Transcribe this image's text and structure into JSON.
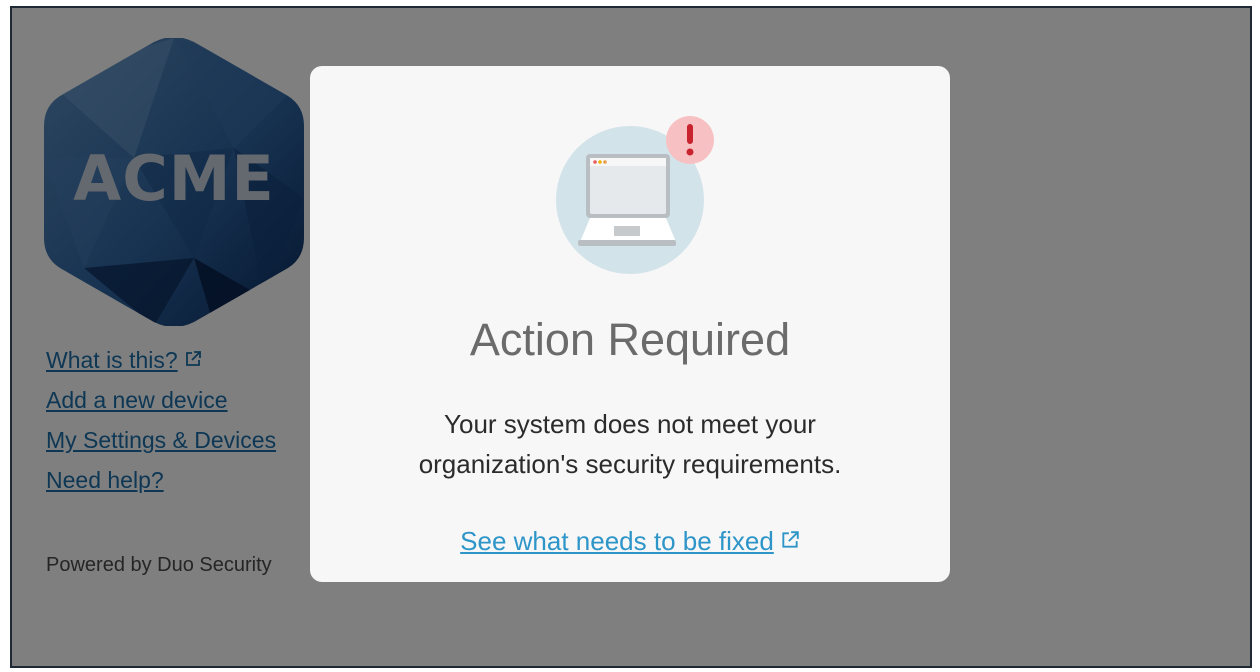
{
  "logo": {
    "text": "ACME"
  },
  "sidebar": {
    "links": [
      {
        "label": "What is this?",
        "external": true
      },
      {
        "label": "Add a new device",
        "external": false
      },
      {
        "label": "My Settings & Devices",
        "external": false
      },
      {
        "label": "Need help?",
        "external": false
      }
    ],
    "powered_by": "Powered by Duo Security"
  },
  "modal": {
    "badge_symbol": "!",
    "title": "Action Required",
    "message": "Your system does not meet your organization's security requirements.",
    "fix_link": "See what needs to be fixed"
  },
  "colors": {
    "link": "#1b6fa8",
    "modal_link": "#2e95c8",
    "alert_badge": "#f7c1c4",
    "alert_mark": "#c9242d",
    "logo_dark": "#0f2f5a"
  }
}
